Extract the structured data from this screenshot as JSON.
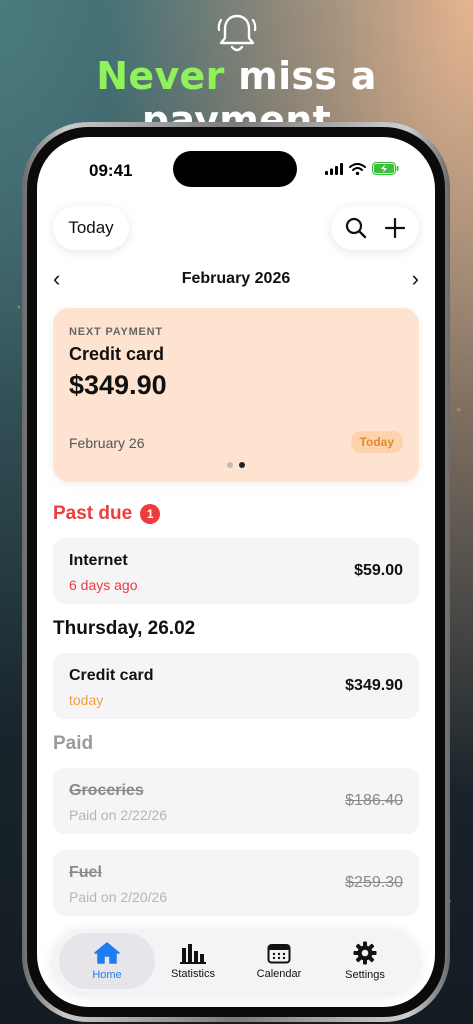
{
  "promo": {
    "headline_accent": "Never",
    "headline_rest": " miss a payment",
    "accent_color": "#8ff25a"
  },
  "status_bar": {
    "time": "09:41"
  },
  "toolbar": {
    "today_label": "Today",
    "search_icon": "search-icon",
    "add_icon": "plus-icon"
  },
  "month_nav": {
    "title": "February 2026",
    "prev": "‹",
    "next": "›"
  },
  "next_payment": {
    "label": "NEXT PAYMENT",
    "name": "Credit card",
    "amount": "$349.90",
    "date": "February 26",
    "badge": "Today",
    "pages": 2,
    "current_page": 2
  },
  "sections": {
    "past_due": {
      "title": "Past due",
      "count": "1"
    },
    "thursday": {
      "title": "Thursday, 26.02"
    },
    "paid": {
      "title": "Paid"
    }
  },
  "rows": [
    {
      "name": "Internet",
      "sub": "6 days ago",
      "amount": "$59.00"
    },
    {
      "name": "Credit card",
      "sub": "today",
      "amount": "$349.90"
    },
    {
      "name": "Groceries",
      "sub": "Paid on 2/22/26",
      "amount": "$186.40"
    },
    {
      "name": "Fuel",
      "sub": "Paid on 2/20/26",
      "amount": "$259.30"
    }
  ],
  "tabs": [
    {
      "label": "Home",
      "icon": "home-icon",
      "active": true
    },
    {
      "label": "Statistics",
      "icon": "chart-icon",
      "active": false
    },
    {
      "label": "Calendar",
      "icon": "calendar-icon",
      "active": false
    },
    {
      "label": "Settings",
      "icon": "gear-icon",
      "active": false
    }
  ],
  "colors": {
    "danger": "#ef3b3b",
    "warning": "#f0a040",
    "accent_blue": "#1f7cf0",
    "card_bg": "#fde3d0"
  }
}
